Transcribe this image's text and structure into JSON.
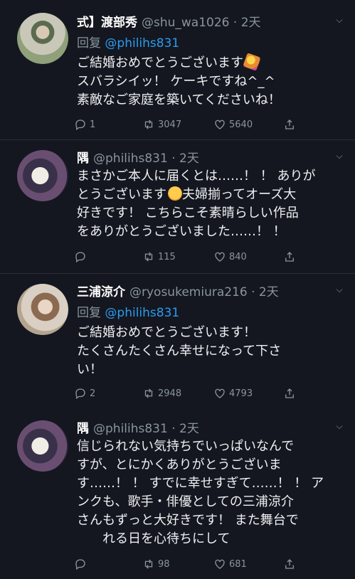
{
  "tweets": [
    {
      "name": "式】渡部秀",
      "handle": "@shu_wa1026 · 2天",
      "reply_prefix": "回复",
      "reply_to": "@philihs831",
      "lines": [
        "ご結婚おめでとうございます",
        "スバラシイッ！ ケーキですね^_^",
        "素敵なご家庭を築いてくださいね！"
      ],
      "emoji_line1": "party-popper",
      "reply_count": "1",
      "retweet_count": "3047",
      "like_count": "5640"
    },
    {
      "name": "隅",
      "handle": "@philihs831 · 2天",
      "lines": [
        "まさかご本人に届くとは……！ ！ ありが",
        "とうございます",
        "夫婦揃ってオーズ大",
        "好きです！ こちらこそ素晴らしい作品",
        "をありがとうございました……！ ！"
      ],
      "emoji_line2": "loudly-crying-face",
      "reply_count": "",
      "retweet_count": "115",
      "like_count": "840"
    },
    {
      "name": "三浦涼介",
      "handle": "@ryosukemiura216 · 2天",
      "reply_prefix": "回复",
      "reply_to": "@philihs831",
      "lines": [
        "ご結婚おめでとうございます！",
        "たくさんたくさん幸せになって下さ",
        "い！"
      ],
      "reply_count": "2",
      "retweet_count": "2948",
      "like_count": "4793"
    },
    {
      "name": "隅",
      "handle": "@philihs831 · 2天",
      "lines": [
        "信じられない気持ちでいっぱいなんで",
        "すが、とにかくありがとうございま",
        "す……！ ！ すでに幸せすぎて……！ ！ ア",
        "ンクも、歌手・俳優としての三浦涼介",
        "さんもずっと大好きです！ また舞台で",
        "れる日を心待ちにして"
      ],
      "reply_count": "",
      "retweet_count": "98",
      "like_count": "681"
    }
  ],
  "icons": {
    "reply": "reply-icon",
    "retweet": "retweet-icon",
    "like": "heart-icon",
    "share": "share-icon",
    "more": "chevron-down-icon"
  },
  "colors": {
    "background": "#14171f",
    "link": "#2b9bf0",
    "muted": "#8a949e"
  }
}
